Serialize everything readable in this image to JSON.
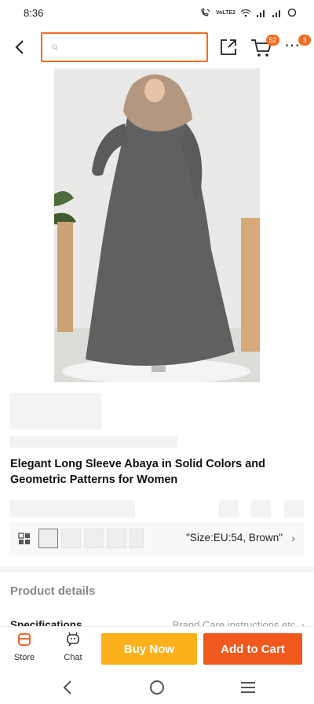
{
  "status_bar": {
    "time": "8:36",
    "network": "VoLTE2",
    "signal_icons": [
      "call-wifi-icon",
      "wifi-icon",
      "signal-icon",
      "signal-icon",
      "battery-icon"
    ]
  },
  "top_bar": {
    "search_placeholder": "",
    "cart_count": "52",
    "more_count": "3"
  },
  "product": {
    "title": "Elegant Long Sleeve Abaya in Solid Colors and Geometric Patterns for Women",
    "selected_variant": "\"Size:EU:54, Brown\""
  },
  "details": {
    "section_title": "Product details",
    "spec_label": "Specifications",
    "spec_value": "Brand Care instructions etc."
  },
  "actions": {
    "store_label": "Store",
    "chat_label": "Chat",
    "buy_now_label": "Buy Now",
    "add_to_cart_label": "Add to Cart"
  },
  "colors": {
    "accent": "#f26d21",
    "buy_now": "#fbb11c",
    "add_to_cart": "#f0591e"
  }
}
